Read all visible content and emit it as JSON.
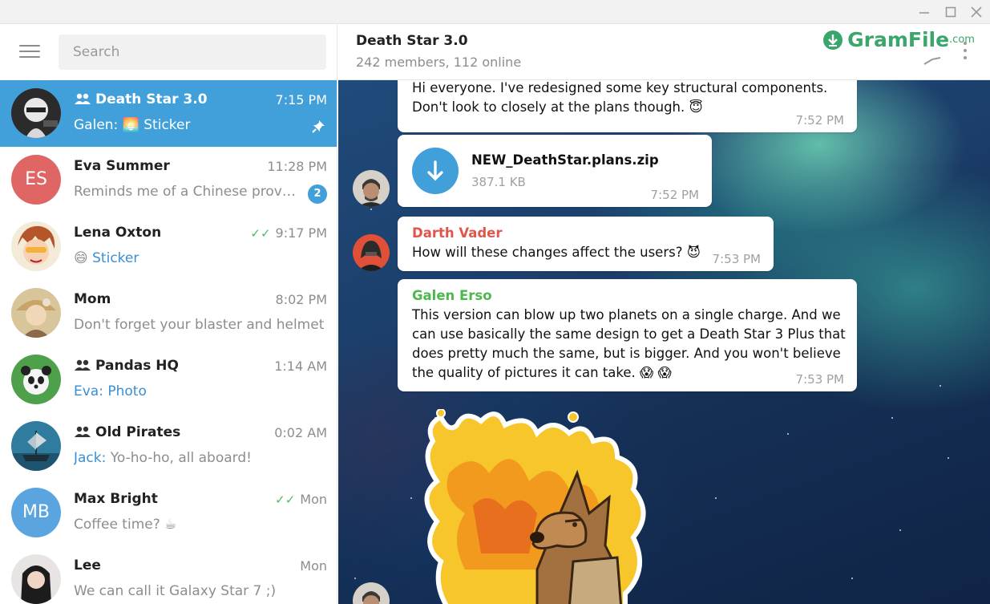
{
  "window": {
    "minimize_icon": "minimize-icon",
    "maximize_icon": "maximize-icon",
    "close_icon": "close-icon"
  },
  "sidebar": {
    "menu_icon": "hamburger-menu-icon",
    "search": {
      "placeholder": "Search",
      "value": ""
    },
    "chats": [
      {
        "name": "Death Star 3.0",
        "group": true,
        "time": "7:15 PM",
        "sender": "Galen:",
        "preview": "Sticker",
        "preview_emoji": "🌅",
        "pinned": true,
        "active": true
      },
      {
        "name": "Eva Summer",
        "initials": "ES",
        "avatar_color": "#e06666",
        "time": "11:28 PM",
        "preview": "Reminds me of a Chinese prove…",
        "unread": "2"
      },
      {
        "name": "Lena Oxton",
        "time": "9:17 PM",
        "read": true,
        "preview_emoji": "😄",
        "preview": "Sticker"
      },
      {
        "name": "Mom",
        "time": "8:02 PM",
        "preview": "Don't forget your blaster and helmet"
      },
      {
        "name": "Pandas HQ",
        "group": true,
        "time": "1:14 AM",
        "preview": "Eva: Photo"
      },
      {
        "name": "Old Pirates",
        "group": true,
        "time": "0:02 AM",
        "sender": "Jack:",
        "preview": "Yo-ho-ho, all aboard!"
      },
      {
        "name": "Max Bright",
        "initials": "MB",
        "avatar_color": "#5aa5df",
        "time": "Mon",
        "read": true,
        "preview": "Coffee time? ☕"
      },
      {
        "name": "Lee",
        "time": "Mon",
        "preview": "We can call it Galaxy Star 7 ;)"
      }
    ]
  },
  "chat": {
    "title": "Death Star 3.0",
    "subtitle": "242 members, 112 online",
    "watermark": {
      "text": "GramFile",
      "suffix": ".com"
    },
    "more_icon": "more-vertical-icon",
    "messages": [
      {
        "text_line1": "Hi everyone. I've redesigned some key structural components.",
        "text_line2": "Don't look to closely at the plans though. 😇",
        "time": "7:52 PM"
      },
      {
        "file_name": "NEW_DeathStar.plans.zip",
        "file_size": "387.1 KB",
        "time": "7:52 PM",
        "icon": "download-icon"
      },
      {
        "sender": "Darth Vader",
        "sender_color": "#e0564b",
        "text": "How will these changes affect the users? 😈",
        "time": "7:53 PM"
      },
      {
        "sender": "Galen Erso",
        "sender_color": "#4eb84e",
        "text_lines": [
          "This version can blow up two planets on a single charge. And we",
          "can use basically the same design to get a Death Star 3 Plus that",
          "does pretty much the same, but is bigger. And you won't believe",
          "the quality of pictures it can take. 😱 😱"
        ],
        "time": "7:53 PM"
      }
    ]
  }
}
